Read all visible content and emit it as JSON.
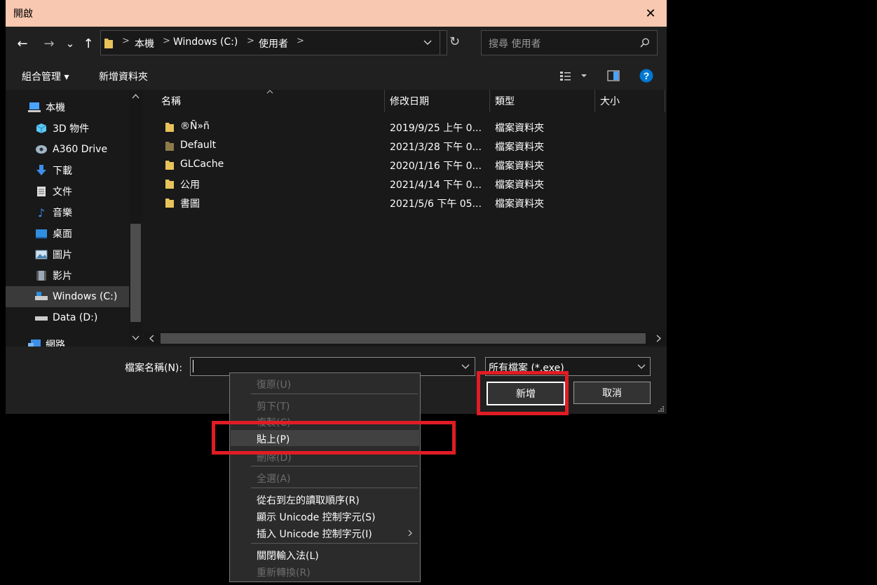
{
  "window": {
    "title": "開啟",
    "close_glyph": "✕"
  },
  "nav": {
    "back": "←",
    "forward": "→",
    "recent": "⌄",
    "up": "↑",
    "breadcrumb": [
      "本機",
      "Windows (C:)",
      "使用者"
    ],
    "refresh": "↻",
    "search_placeholder": "搜尋 使用者"
  },
  "toolbar": {
    "organize": "組合管理 ▾",
    "new_folder": "新增資料夾"
  },
  "sidebar": {
    "items": [
      {
        "label": "本機",
        "icon": "pc-icon"
      },
      {
        "label": "3D 物件",
        "icon": "cube-icon"
      },
      {
        "label": "A360 Drive",
        "icon": "cloud-drive-icon"
      },
      {
        "label": "下載",
        "icon": "download-icon"
      },
      {
        "label": "文件",
        "icon": "document-icon"
      },
      {
        "label": "音樂",
        "icon": "music-icon"
      },
      {
        "label": "桌面",
        "icon": "desktop-icon"
      },
      {
        "label": "圖片",
        "icon": "picture-icon"
      },
      {
        "label": "影片",
        "icon": "video-icon"
      },
      {
        "label": "Windows (C:)",
        "icon": "drive-c-icon"
      },
      {
        "label": "Data (D:)",
        "icon": "drive-d-icon"
      },
      {
        "label": "網路",
        "icon": "network-icon"
      }
    ]
  },
  "columns": {
    "name": "名稱",
    "date": "修改日期",
    "type": "類型",
    "size": "大小"
  },
  "files": [
    {
      "name": "®Ñ»ñ",
      "date": "2019/9/25 上午 0...",
      "type": "檔案資料夾"
    },
    {
      "name": "Default",
      "date": "2021/3/28 下午 0...",
      "type": "檔案資料夾"
    },
    {
      "name": "GLCache",
      "date": "2020/1/16 下午 0...",
      "type": "檔案資料夾"
    },
    {
      "name": "公用",
      "date": "2021/4/14 下午 0...",
      "type": "檔案資料夾"
    },
    {
      "name": "書圖",
      "date": "2021/5/6 下午 05...",
      "type": "檔案資料夾"
    }
  ],
  "bottom": {
    "filename_label": "檔案名稱(N):",
    "filename_value": "",
    "filetype_value": "所有檔案 (*.exe)",
    "ok_button": "新增",
    "cancel_button": "取消"
  },
  "context_menu": [
    {
      "label": "復原(U)",
      "enabled": false
    },
    {
      "label": "剪下(T)",
      "enabled": false
    },
    {
      "label": "複製(C)",
      "enabled": false
    },
    {
      "label": "貼上(P)",
      "enabled": true
    },
    {
      "label": "刪除(D)",
      "enabled": false
    },
    {
      "label": "全選(A)",
      "enabled": false
    },
    {
      "label": "從右到左的讀取順序(R)",
      "enabled": true
    },
    {
      "label": "顯示 Unicode 控制字元(S)",
      "enabled": true
    },
    {
      "label": "插入 Unicode 控制字元(I)",
      "enabled": true
    },
    {
      "label": "關閉輸入法(L)",
      "enabled": true
    },
    {
      "label": "重新轉換(R)",
      "enabled": false
    }
  ],
  "colors": {
    "titlebar": "#f8c8b0",
    "highlight": "#e01c24",
    "accent": "#0078d4"
  }
}
